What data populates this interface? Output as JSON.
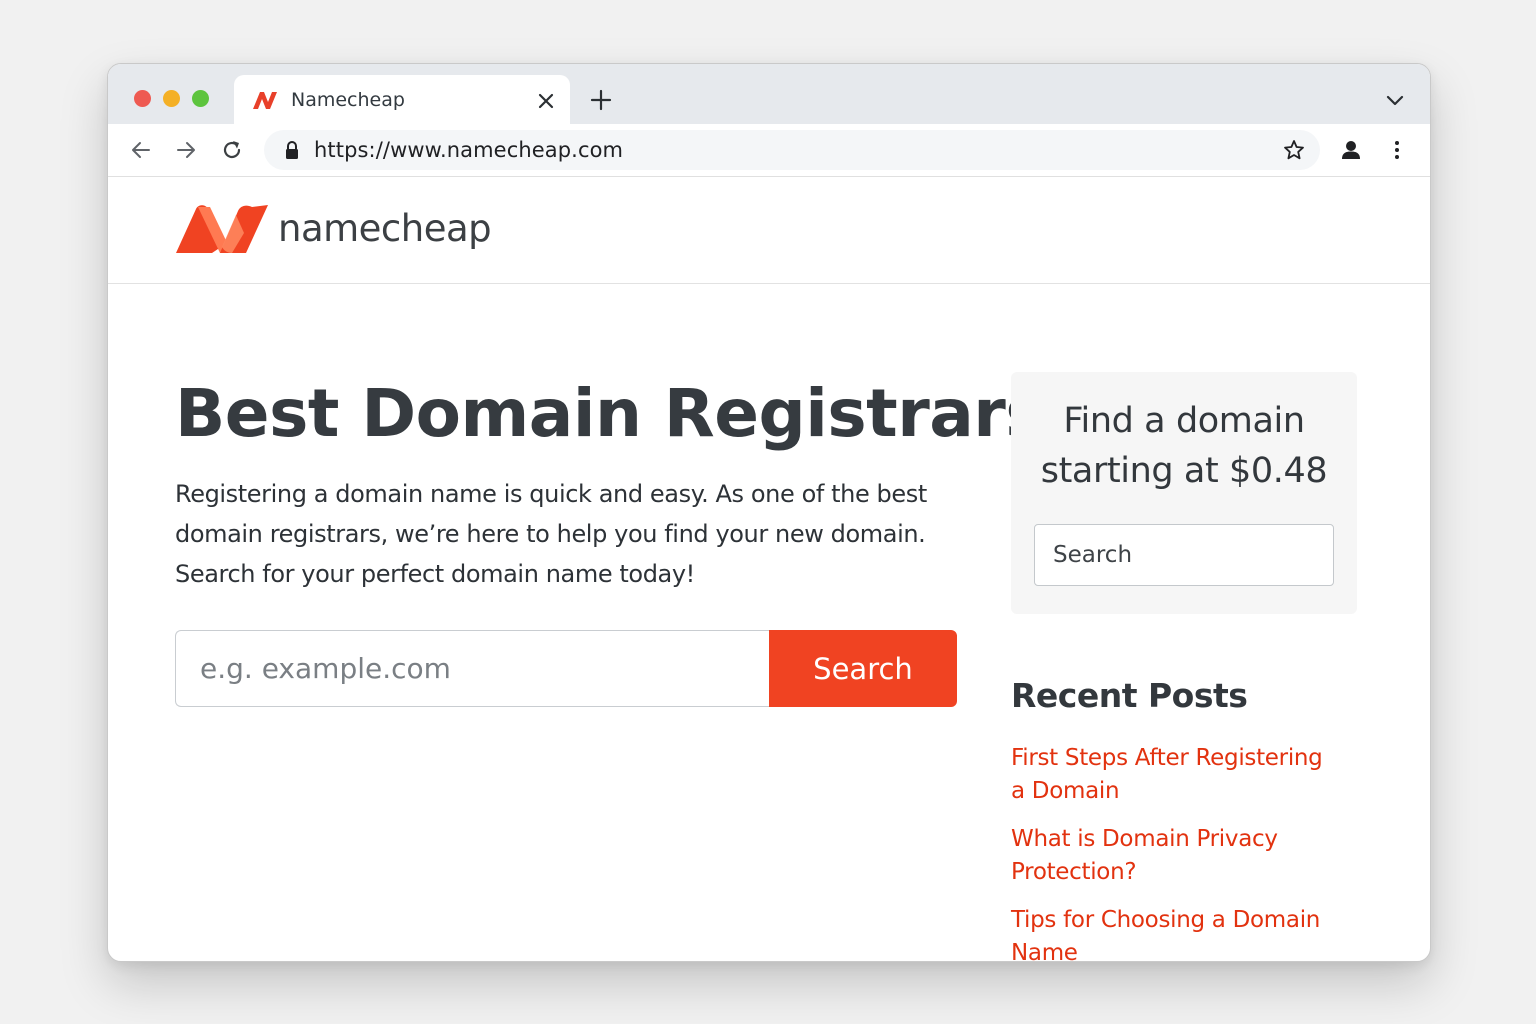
{
  "browser": {
    "tab_title": "Namecheap",
    "url": "https://www.namecheap.com"
  },
  "site": {
    "logo_text": "namecheap",
    "brand_color": "#f04322"
  },
  "hero": {
    "title": "Best Domain Registrars",
    "description": "Registering a domain name is quick and easy. As one of the best domain registrars, we’re here to help you find your new domain. Search for your perfect domain name today!",
    "input_placeholder": "e.g. example.com",
    "search_label": "Search"
  },
  "sidebar": {
    "find_title": "Find a domain starting at $0.48",
    "search_placeholder": "Search",
    "recent_title": "Recent Posts",
    "posts": [
      "First Steps After Registering a Domain",
      "What is Domain Privacy Protection?",
      "Tips for Choosing a Domain Name"
    ]
  },
  "icons": {
    "tab_favicon": "namecheap-logo-icon",
    "close": "close-icon",
    "new_tab": "plus-icon",
    "tab_menu": "chevron-down-icon",
    "back": "arrow-left-icon",
    "forward": "arrow-right-icon",
    "reload": "reload-icon",
    "lock": "lock-icon",
    "bookmark": "star-icon",
    "profile": "person-icon",
    "menu": "kebab-menu-icon"
  }
}
